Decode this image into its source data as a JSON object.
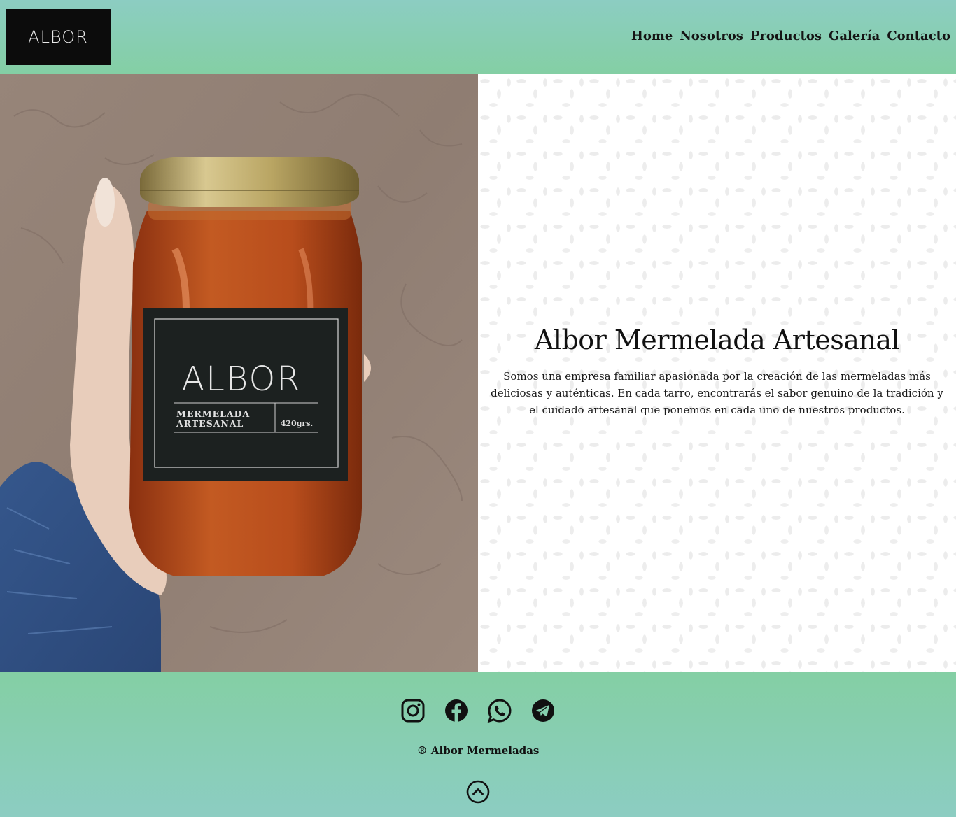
{
  "brand": {
    "logo_text": "ALBOR"
  },
  "nav": {
    "items": [
      {
        "label": "Home",
        "active": true
      },
      {
        "label": "Nosotros"
      },
      {
        "label": "Productos"
      },
      {
        "label": "Galería"
      },
      {
        "label": "Contacto"
      }
    ]
  },
  "hero": {
    "image": {
      "jar_brand": "ALBOR",
      "jar_line1": "MERMELADA",
      "jar_line2": "ARTESANAL",
      "jar_weight": "420grs."
    },
    "title": "Albor Mermelada Artesanal",
    "description": "Somos una empresa familiar apasionada por la creación de las mermeladas más deliciosas y auténticas. En cada tarro, encontrarás el sabor genuino de la tradición y el cuidado artesanal que ponemos en cada uno de nuestros productos."
  },
  "footer": {
    "socials": [
      {
        "icon": "instagram-icon"
      },
      {
        "icon": "facebook-icon"
      },
      {
        "icon": "whatsapp-icon"
      },
      {
        "icon": "telegram-icon"
      }
    ],
    "copyright": "® Albor Mermeladas",
    "back_to_top_icon": "chevron-up-circle-icon"
  },
  "colors": {
    "header_gradient_top": "#8ccdc2",
    "header_gradient_bottom": "#84cfa4",
    "logo_bg": "#0c0c0c",
    "text": "#111111"
  }
}
